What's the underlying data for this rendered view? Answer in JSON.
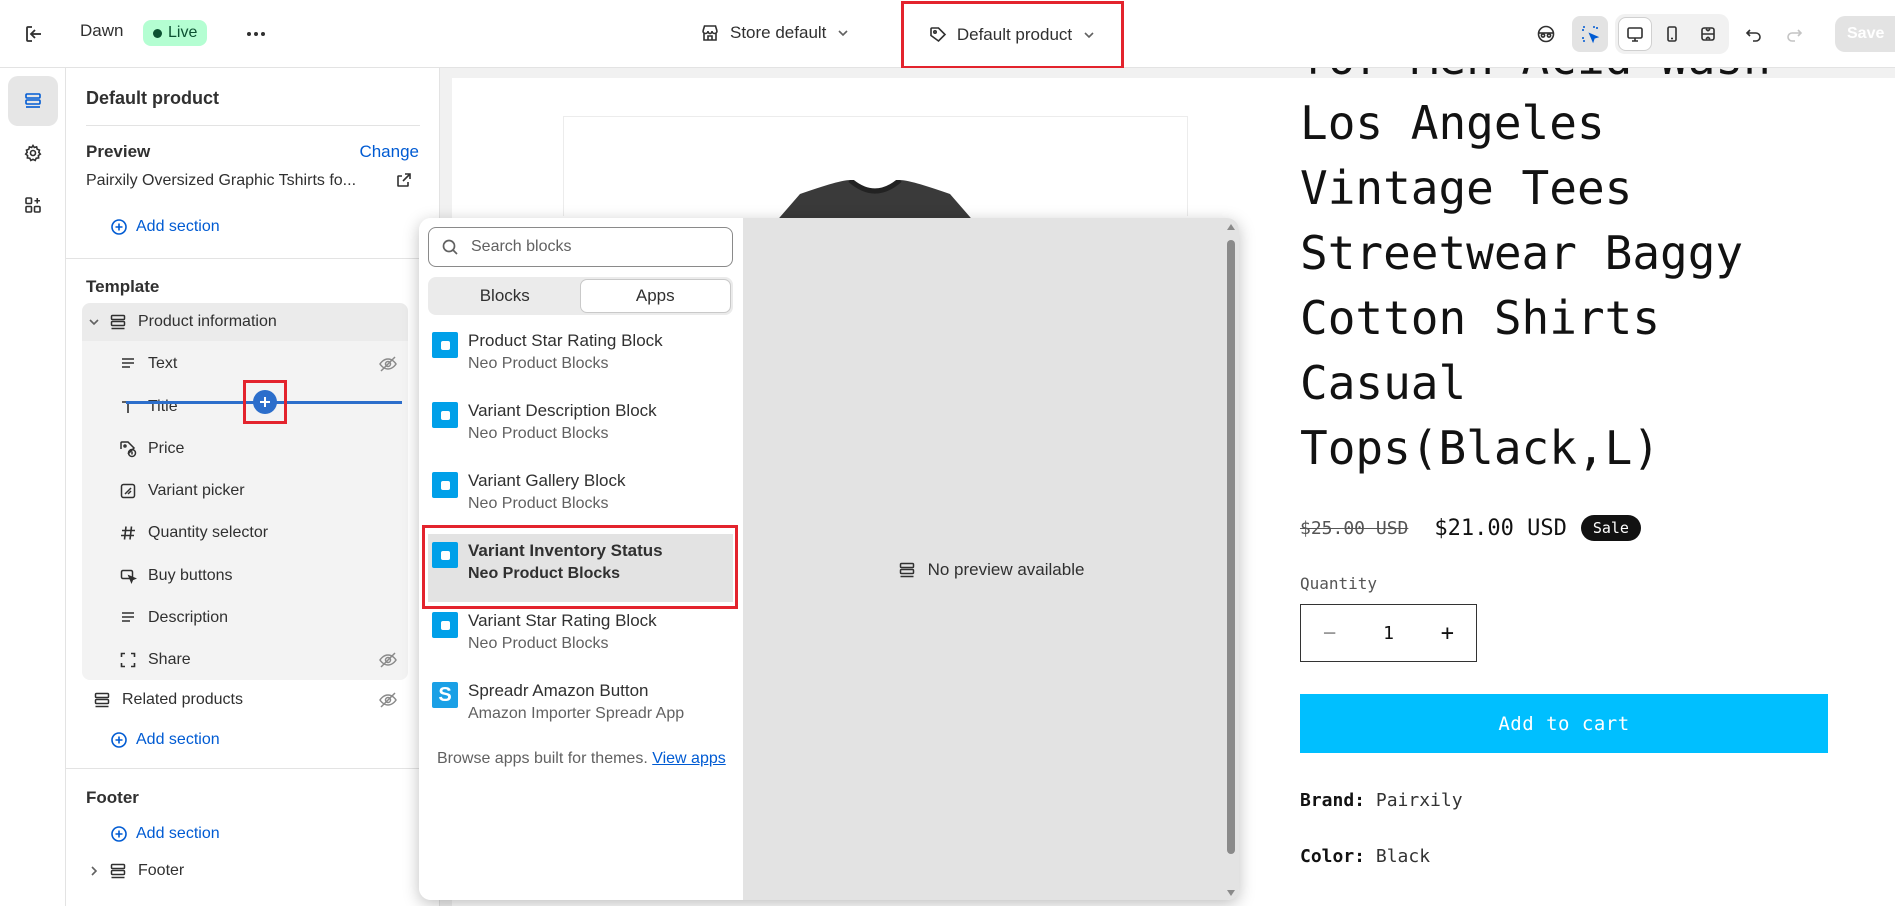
{
  "topbar": {
    "theme_name": "Dawn",
    "live_label": "Live",
    "store_selector": "Store default",
    "template_selector": "Default product",
    "save_label": "Save"
  },
  "sidebar": {
    "title": "Default product",
    "preview_label": "Preview",
    "change_label": "Change",
    "preview_value": "Pairxily Oversized Graphic Tshirts fo...",
    "add_section": "Add section",
    "template_title": "Template",
    "section_product_information": "Product information",
    "blocks": [
      {
        "label": "Text",
        "icon": "text-icon",
        "hidden": true
      },
      {
        "label": "Title",
        "icon": "title-icon",
        "hidden": false
      },
      {
        "label": "Price",
        "icon": "price-tag-icon",
        "hidden": false
      },
      {
        "label": "Variant picker",
        "icon": "variant-picker-icon",
        "hidden": false
      },
      {
        "label": "Quantity selector",
        "icon": "hash-icon",
        "hidden": false
      },
      {
        "label": "Buy buttons",
        "icon": "cursor-icon",
        "hidden": false
      },
      {
        "label": "Description",
        "icon": "text-icon",
        "hidden": false
      },
      {
        "label": "Share",
        "icon": "share-icon",
        "hidden": true
      }
    ],
    "related_products": "Related products",
    "footer_title": "Footer",
    "footer_section": "Footer"
  },
  "popover": {
    "search_placeholder": "Search blocks",
    "tabs": [
      {
        "label": "Blocks",
        "active": false
      },
      {
        "label": "Apps",
        "active": true
      }
    ],
    "apps": [
      {
        "name": "Product Star Rating Block",
        "vendor": "Neo Product Blocks"
      },
      {
        "name": "Variant Description Block",
        "vendor": "Neo Product Blocks"
      },
      {
        "name": "Variant Gallery Block",
        "vendor": "Neo Product Blocks"
      },
      {
        "name": "Variant Inventory Status",
        "vendor": "Neo Product Blocks"
      },
      {
        "name": "Variant Star Rating Block",
        "vendor": "Neo Product Blocks"
      },
      {
        "name": "Spreadr Amazon Button",
        "vendor": "Amazon Importer Spreadr App"
      }
    ],
    "browse_text": "Browse apps built for themes.",
    "browse_link": "View apps",
    "no_preview": "No preview available"
  },
  "product": {
    "title_lines": [
      "for Men Acid Wash",
      "Los Angeles",
      "Vintage Tees",
      "Streetwear Baggy",
      "Cotton Shirts",
      "Casual",
      "Tops(Black,L)"
    ],
    "price_old": "$25.00 USD",
    "price_new": "$21.00 USD",
    "sale_badge": "Sale",
    "quantity_label": "Quantity",
    "quantity_value": "1",
    "add_to_cart": "Add to cart",
    "brand_label": "Brand:",
    "brand_value": "Pairxily",
    "color_label": "Color:",
    "color_value": "Black"
  },
  "colors": {
    "accent": "#005bd3",
    "cta": "#00bfff",
    "highlight": "#e3232d",
    "live_bg": "#b4fed2"
  }
}
